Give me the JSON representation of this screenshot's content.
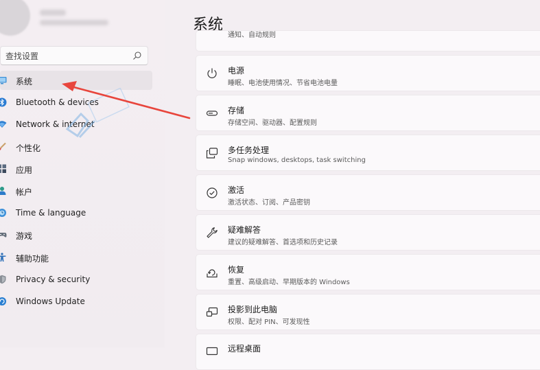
{
  "search": {
    "placeholder": "查找设置"
  },
  "sidebar": {
    "items": [
      {
        "label": "系统",
        "icon": "monitor-icon",
        "selected": true
      },
      {
        "label": "Bluetooth & devices",
        "icon": "bluetooth-icon"
      },
      {
        "label": "Network & internet",
        "icon": "wifi-icon"
      },
      {
        "label": "个性化",
        "icon": "paintbrush-icon"
      },
      {
        "label": "应用",
        "icon": "apps-icon"
      },
      {
        "label": "帐户",
        "icon": "person-icon"
      },
      {
        "label": "Time & language",
        "icon": "globe-clock-icon"
      },
      {
        "label": "游戏",
        "icon": "gamepad-icon"
      },
      {
        "label": "辅助功能",
        "icon": "accessibility-icon"
      },
      {
        "label": "Privacy & security",
        "icon": "shield-icon"
      },
      {
        "label": "Windows Update",
        "icon": "update-icon"
      }
    ]
  },
  "main": {
    "title": "系统",
    "top_card_sub": "通知、自动规则",
    "cards": [
      {
        "title": "电源",
        "subtitle": "睡眠、电池使用情况、节省电池电量",
        "icon": "power-icon"
      },
      {
        "title": "存储",
        "subtitle": "存储空间、驱动器、配置规则",
        "icon": "storage-icon"
      },
      {
        "title": "多任务处理",
        "subtitle": "Snap windows, desktops, task switching",
        "icon": "multitask-icon"
      },
      {
        "title": "激活",
        "subtitle": "激活状态、订阅、产品密钥",
        "icon": "check-circle-icon"
      },
      {
        "title": "疑难解答",
        "subtitle": "建议的疑难解答、首选项和历史记录",
        "icon": "wrench-icon"
      },
      {
        "title": "恢复",
        "subtitle": "重置、高级启动、早期版本的 Windows",
        "icon": "recovery-icon"
      },
      {
        "title": "投影到此电脑",
        "subtitle": "权限、配对 PIN、可发现性",
        "icon": "project-icon"
      },
      {
        "title": "远程桌面",
        "subtitle": "",
        "icon": "remote-desktop-icon"
      }
    ]
  },
  "colors": {
    "accent": "#0067c0",
    "arrow": "#e8453c"
  }
}
